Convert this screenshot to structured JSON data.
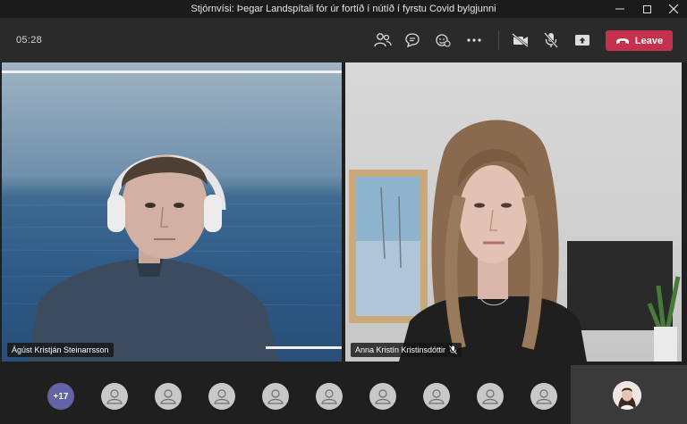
{
  "window": {
    "title": "Stjórnvísi: Þegar Landspítali fór úr fortíð í nútíð í fyrstu Covid bylgjunni"
  },
  "toolbar": {
    "timer": "05:28",
    "leave_label": "Leave",
    "icons": [
      "people-icon",
      "chat-icon",
      "reactions-icon",
      "more-icon",
      "camera-off-icon",
      "mic-off-icon",
      "share-icon",
      "phone-hangup-icon"
    ]
  },
  "participants": {
    "left_name": "Ágúst Kristján Steinarrsson",
    "right_name": "Anna Kristín Kristinsdóttir",
    "more_count": "+17",
    "avatar_count": 9
  },
  "colors": {
    "leave": "#c4314b",
    "badge": "#6264a7",
    "toolbar": "#2a2a2a"
  }
}
